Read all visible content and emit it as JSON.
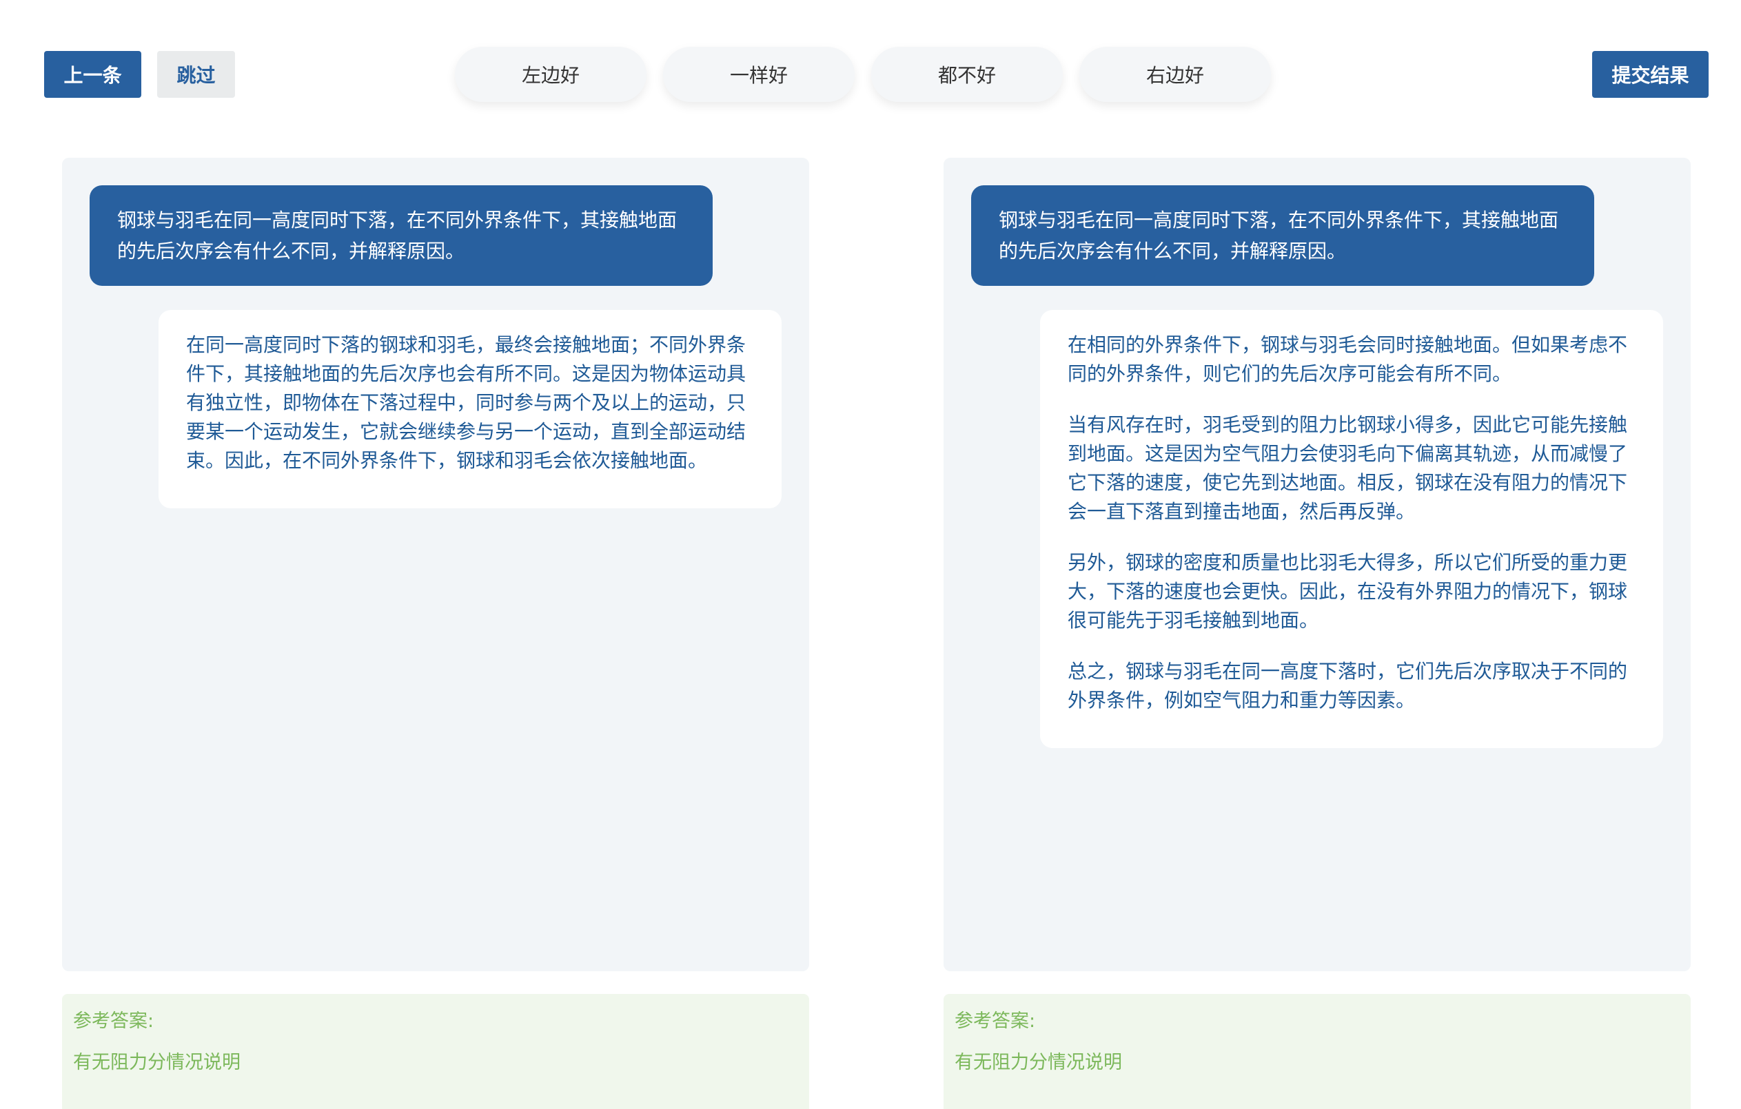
{
  "toolbar": {
    "prev_label": "上一条",
    "skip_label": "跳过",
    "submit_label": "提交结果",
    "choices": [
      "左边好",
      "一样好",
      "都不好",
      "右边好"
    ]
  },
  "left": {
    "question": "钢球与羽毛在同一高度同时下落，在不同外界条件下，其接触地面的先后次序会有什么不同，并解释原因。",
    "answer_paragraphs": [
      "在同一高度同时下落的钢球和羽毛，最终会接触地面；不同外界条件下，其接触地面的先后次序也会有所不同。这是因为物体运动具有独立性，即物体在下落过程中，同时参与两个及以上的运动，只要某一个运动发生，它就会继续参与另一个运动，直到全部运动结束。因此，在不同外界条件下，钢球和羽毛会依次接触地面。"
    ],
    "reference_label": "参考答案:",
    "reference_text": "有无阻力分情况说明"
  },
  "right": {
    "question": "钢球与羽毛在同一高度同时下落，在不同外界条件下，其接触地面的先后次序会有什么不同，并解释原因。",
    "answer_paragraphs": [
      "在相同的外界条件下，钢球与羽毛会同时接触地面。但如果考虑不同的外界条件，则它们的先后次序可能会有所不同。",
      "当有风存在时，羽毛受到的阻力比钢球小得多，因此它可能先接触到地面。这是因为空气阻力会使羽毛向下偏离其轨迹，从而减慢了它下落的速度，使它先到达地面。相反，钢球在没有阻力的情况下会一直下落直到撞击地面，然后再反弹。",
      "另外，钢球的密度和质量也比羽毛大得多，所以它们所受的重力更大，下落的速度也会更快。因此，在没有外界阻力的情况下，钢球很可能先于羽毛接触到地面。",
      "总之，钢球与羽毛在同一高度下落时，它们先后次序取决于不同的外界条件，例如空气阻力和重力等因素。"
    ],
    "reference_label": "参考答案:",
    "reference_text": "有无阻力分情况说明"
  }
}
